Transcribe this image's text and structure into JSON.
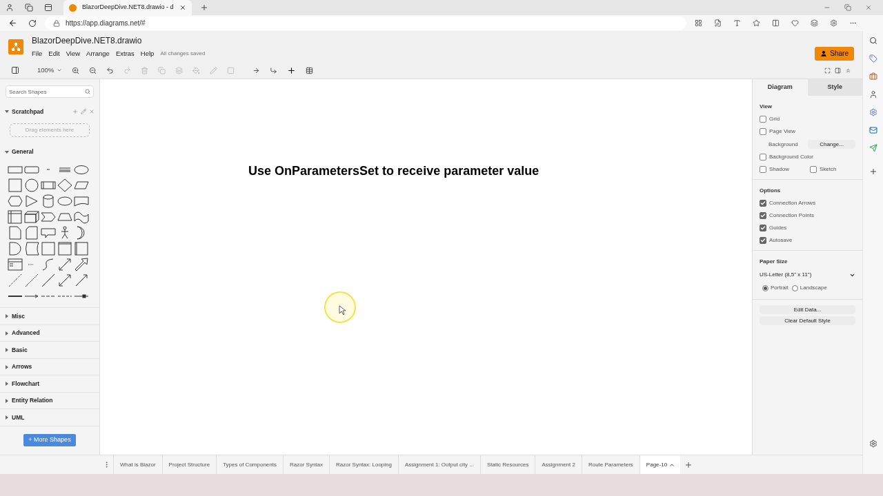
{
  "browser": {
    "tab_title": "BlazorDeepDive.NET8.drawio - d",
    "url": "https://app.diagrams.net/#"
  },
  "app": {
    "file_name": "BlazorDeepDive.NET8.drawio",
    "menus": [
      "File",
      "Edit",
      "View",
      "Arrange",
      "Extras",
      "Help"
    ],
    "status": "All changes saved",
    "share": "Share"
  },
  "toolbar": {
    "zoom": "100%"
  },
  "sidebar": {
    "search_placeholder": "Search Shapes",
    "scratchpad": {
      "title": "Scratchpad",
      "expanded": true,
      "hint": "Drag elements here"
    },
    "sections": [
      {
        "label": "General",
        "expanded": true
      },
      {
        "label": "Misc",
        "expanded": false
      },
      {
        "label": "Advanced",
        "expanded": false
      },
      {
        "label": "Basic",
        "expanded": false
      },
      {
        "label": "Arrows",
        "expanded": false
      },
      {
        "label": "Flowchart",
        "expanded": false
      },
      {
        "label": "Entity Relation",
        "expanded": false
      },
      {
        "label": "UML",
        "expanded": false
      }
    ],
    "more_shapes": "+ More Shapes"
  },
  "canvas": {
    "title": "Use OnParametersSet to receive parameter value"
  },
  "format_panel": {
    "tabs": [
      {
        "label": "Diagram",
        "selected": true
      },
      {
        "label": "Style",
        "selected": false
      }
    ],
    "view_heading": "View",
    "grid": {
      "label": "Grid",
      "checked": false
    },
    "page_view": {
      "label": "Page View",
      "checked": false
    },
    "background_label": "Background",
    "change_button": "Change...",
    "background_color": {
      "label": "Background Color",
      "checked": false
    },
    "shadow": {
      "label": "Shadow",
      "checked": false
    },
    "sketch": {
      "label": "Sketch",
      "checked": false
    },
    "options_heading": "Options",
    "options": [
      {
        "label": "Connection Arrows",
        "checked": true
      },
      {
        "label": "Connection Points",
        "checked": true
      },
      {
        "label": "Guides",
        "checked": true
      },
      {
        "label": "Autosave",
        "checked": true
      }
    ],
    "paper_heading": "Paper Size",
    "paper_size": "US-Letter (8,5\" x 11\")",
    "orientation": [
      {
        "label": "Portrait",
        "selected": true
      },
      {
        "label": "Landscape",
        "selected": false
      }
    ],
    "buttons": [
      "Edit Data...",
      "Clear Default Style"
    ]
  },
  "page_tabs": [
    {
      "label": "What is Blazor",
      "selected": false
    },
    {
      "label": "Project Structure",
      "selected": false
    },
    {
      "label": "Types of Components",
      "selected": false
    },
    {
      "label": "Razor Syntax",
      "selected": false
    },
    {
      "label": "Razor Syntax: Looping",
      "selected": false
    },
    {
      "label": "Assignment 1: Output city ...",
      "selected": false
    },
    {
      "label": "Static Resources",
      "selected": false
    },
    {
      "label": "Assignment 2",
      "selected": false
    },
    {
      "label": "Route Parameters",
      "selected": false
    },
    {
      "label": "Page-10",
      "selected": true
    }
  ]
}
